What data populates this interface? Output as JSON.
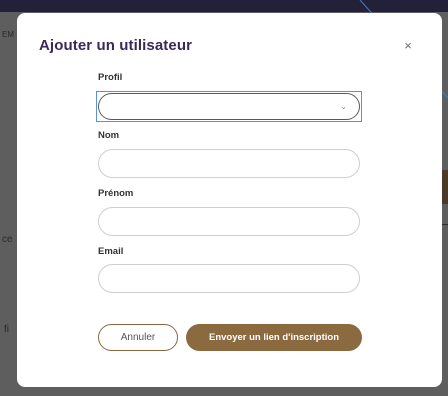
{
  "background": {
    "topbar_text": "",
    "left_text_1": "EM",
    "left_text_2": "ce",
    "left_text_3": "fi"
  },
  "modal": {
    "title": "Ajouter un utilisateur",
    "close_label": "×",
    "fields": {
      "profil_label": "Profil",
      "profil_value": "",
      "nom_label": "Nom",
      "nom_value": "",
      "prenom_label": "Prénom",
      "prenom_value": "",
      "email_label": "Email",
      "email_value": ""
    },
    "chevron": "⌄",
    "cancel_label": "Annuler",
    "submit_label": "Envoyer un lien d'inscription"
  },
  "colors": {
    "title": "#3b2a57",
    "brand_brown": "#8b6a40",
    "focus_blue": "#5b8fd6",
    "overlay": "#5e5e5e"
  }
}
